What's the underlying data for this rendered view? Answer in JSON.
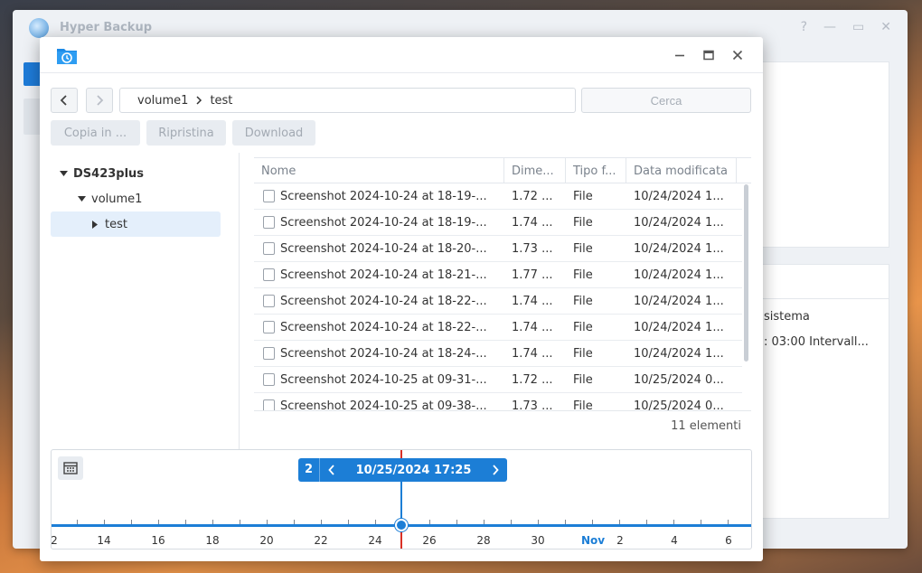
{
  "background_window": {
    "title": "Hyper Backup",
    "help": "?",
    "lines": [
      "sistema",
      ": 03:00 Intervall..."
    ]
  },
  "toolbar": {
    "copy_label": "Copia in ...",
    "restore_label": "Ripristina",
    "download_label": "Download"
  },
  "path": {
    "segments": [
      "volume1",
      "test"
    ]
  },
  "search": {
    "placeholder": "Cerca"
  },
  "tree": {
    "root": "DS423plus",
    "volume": "volume1",
    "folder": "test"
  },
  "list": {
    "columns": [
      "Nome",
      "Dime...",
      "Tipo f...",
      "Data modificata"
    ],
    "rows": [
      {
        "name": "Screenshot 2024-10-24 at 18-19-...",
        "size": "1.72 ...",
        "type": "File",
        "date": "10/24/2024 1..."
      },
      {
        "name": "Screenshot 2024-10-24 at 18-19-...",
        "size": "1.74 ...",
        "type": "File",
        "date": "10/24/2024 1..."
      },
      {
        "name": "Screenshot 2024-10-24 at 18-20-...",
        "size": "1.73 ...",
        "type": "File",
        "date": "10/24/2024 1..."
      },
      {
        "name": "Screenshot 2024-10-24 at 18-21-...",
        "size": "1.77 ...",
        "type": "File",
        "date": "10/24/2024 1..."
      },
      {
        "name": "Screenshot 2024-10-24 at 18-22-...",
        "size": "1.74 ...",
        "type": "File",
        "date": "10/24/2024 1..."
      },
      {
        "name": "Screenshot 2024-10-24 at 18-22-...",
        "size": "1.74 ...",
        "type": "File",
        "date": "10/24/2024 1..."
      },
      {
        "name": "Screenshot 2024-10-24 at 18-24-...",
        "size": "1.74 ...",
        "type": "File",
        "date": "10/24/2024 1..."
      },
      {
        "name": "Screenshot 2024-10-25 at 09-31-...",
        "size": "1.72 ...",
        "type": "File",
        "date": "10/25/2024 0..."
      },
      {
        "name": "Screenshot 2024-10-25 at 09-38-...",
        "size": "1.73 ...",
        "type": "File",
        "date": "10/25/2024 0..."
      }
    ],
    "count_label": "11 elementi"
  },
  "timeline": {
    "version_count": "2",
    "current": "10/25/2024 17:25",
    "labels": [
      "2",
      "14",
      "16",
      "18",
      "20",
      "22",
      "24",
      "26",
      "28",
      "30",
      "Nov",
      "2",
      "4",
      "6"
    ]
  },
  "colors": {
    "accent": "#1c7ed6",
    "marker": "#d93025"
  }
}
